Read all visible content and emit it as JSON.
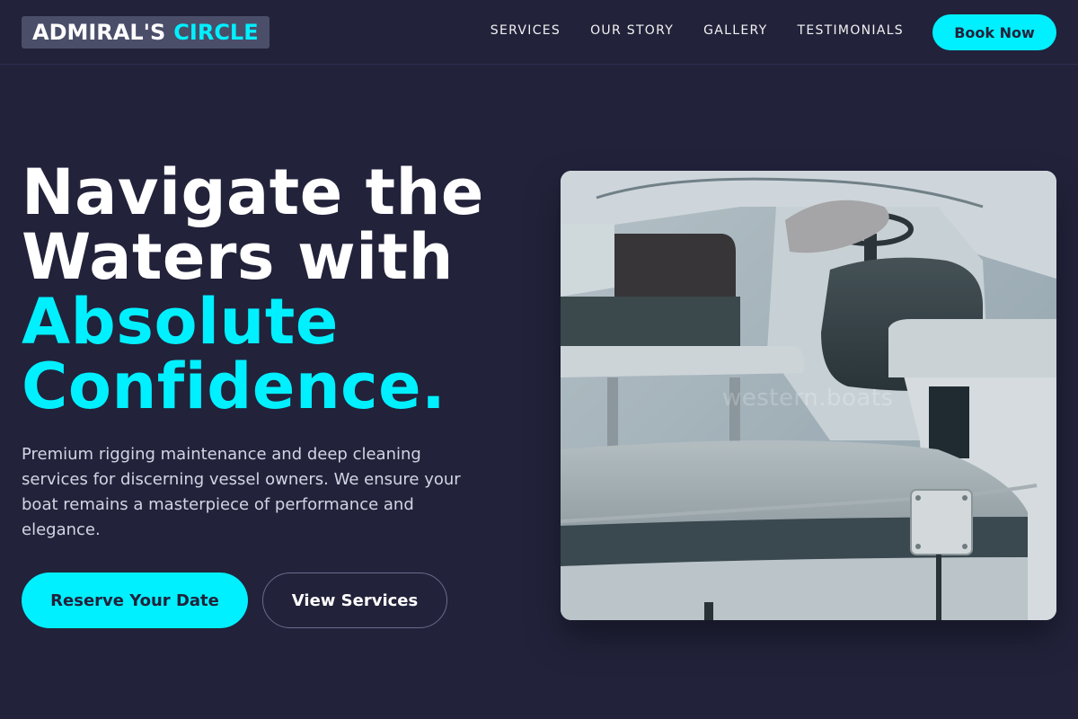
{
  "brand": {
    "name_part1": "ADMIRAL'S",
    "name_part2": "CIRCLE",
    "accent_color": "#00f0ff",
    "background_color": "#22223b"
  },
  "nav": {
    "links": [
      {
        "label": "SERVICES"
      },
      {
        "label": "OUR STORY"
      },
      {
        "label": "GALLERY"
      },
      {
        "label": "TESTIMONIALS"
      }
    ],
    "cta_label": "Book Now"
  },
  "hero": {
    "title_line1": "Navigate the",
    "title_line2": "Waters with",
    "title_line3": "Absolute",
    "title_line4": "Confidence.",
    "description": "Premium rigging maintenance and deep cleaning services for discerning vessel owners. We ensure your boat remains a masterpiece of performance and elegance.",
    "primary_button": "Reserve Your Date",
    "secondary_button": "View Services",
    "image_watermark": "western.boats"
  }
}
